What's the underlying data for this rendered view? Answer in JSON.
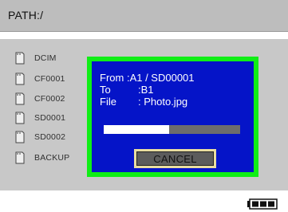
{
  "path": {
    "label": "PATH:/"
  },
  "files": [
    {
      "name": "DCIM"
    },
    {
      "name": "CF0001"
    },
    {
      "name": "CF0002"
    },
    {
      "name": "SD0001"
    },
    {
      "name": "SD0002"
    },
    {
      "name": "BACKUP"
    }
  ],
  "dialog": {
    "from_key": "From :",
    "from_value": "A1 / SD00001",
    "to_key": "To",
    "to_value": ":B1",
    "file_key": "File",
    "file_value": ": Photo.jpg",
    "progress": 0.48,
    "cancel_label": "CANCEL"
  },
  "status": {
    "battery_icon": "battery-full-icon",
    "battery_level": 1.0
  },
  "colors": {
    "path_bar": "#bdbdbd",
    "panel": "#c8c8c8",
    "dialog_border": "#10ee16",
    "dialog_bg": "#0514c8",
    "progress_fill": "#ffffff",
    "progress_track": "#6d6d6d",
    "cancel_frame": "#e8dda0",
    "cancel_bg": "#5c5c5c"
  }
}
